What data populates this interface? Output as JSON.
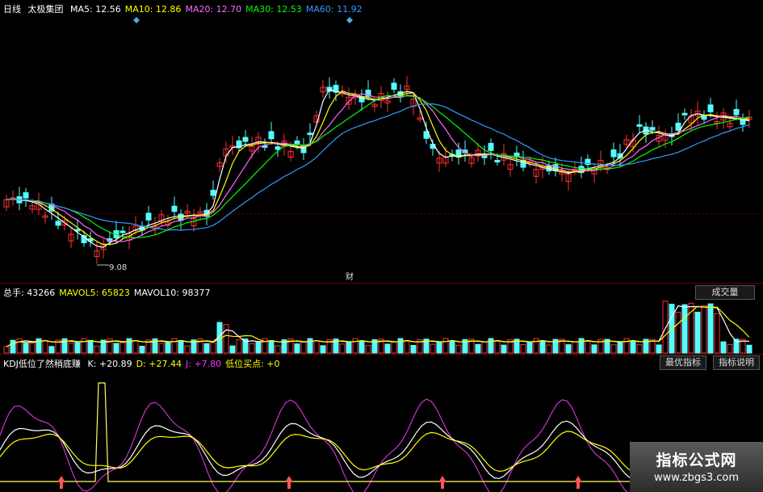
{
  "main": {
    "period": "日线",
    "stock_name": "太极集团",
    "ma": [
      {
        "label": "MA5:",
        "value": "12.56",
        "color": "#ffffff"
      },
      {
        "label": "MA10:",
        "value": "12.86",
        "color": "#ffff00"
      },
      {
        "label": "MA20:",
        "value": "12.70",
        "color": "#ff66ff"
      },
      {
        "label": "MA30:",
        "value": "12.53",
        "color": "#00ff00"
      },
      {
        "label": "MA60:",
        "value": "11.92",
        "color": "#3399ff"
      }
    ],
    "low_price_label": "9.08",
    "finance_marker": "财"
  },
  "volume": {
    "items": [
      {
        "label": "总手:",
        "value": "43266",
        "color": "#ffffff"
      },
      {
        "label": "MAVOL5:",
        "value": "65823",
        "color": "#ffff00"
      },
      {
        "label": "MAVOL10:",
        "value": "98377",
        "color": "#ffffff"
      }
    ],
    "button": "成交量"
  },
  "kdj": {
    "title": "KDJ低位了然稍底赚",
    "items": [
      {
        "label": "K:",
        "value": "+20.89",
        "color": "#ffffff"
      },
      {
        "label": "D:",
        "value": "+27.44",
        "color": "#ffff00"
      },
      {
        "label": "J:",
        "value": "+7.80",
        "color": "#ff33ff"
      },
      {
        "label": "低位买点:",
        "value": "+0",
        "color": "#ffff00"
      }
    ],
    "buttons": [
      "最优指标",
      "指标说明"
    ]
  },
  "watermark": {
    "title": "指标公式网",
    "url": "www.zbgs3.com"
  },
  "colors": {
    "up": "#ff3232",
    "down": "#54fcfc",
    "grid": "#6b0000"
  }
}
